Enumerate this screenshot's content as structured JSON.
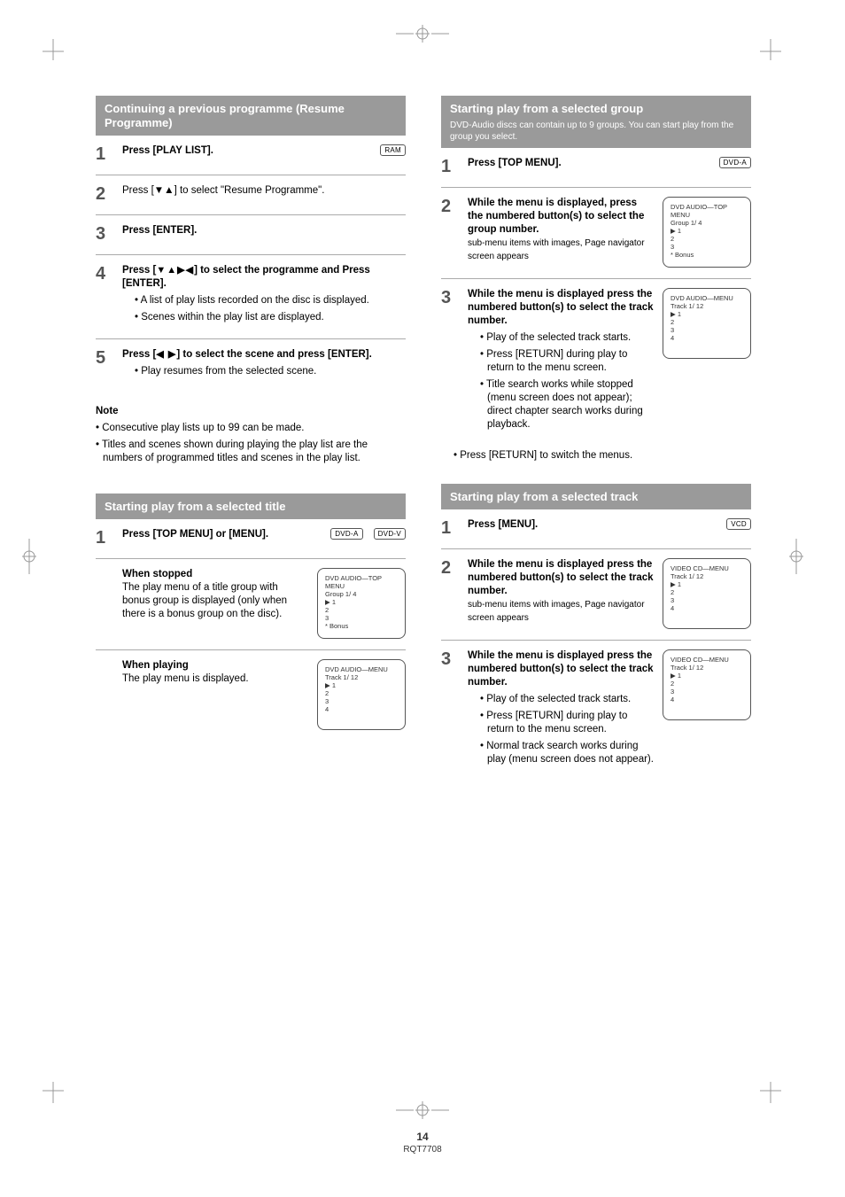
{
  "footer": {
    "page_number": "14",
    "label": "RQT7708"
  },
  "badges": {
    "ram": "RAM",
    "dvd_a": "DVD-A",
    "dvd_v": "DVD-V",
    "vcd": "VCD"
  },
  "left": {
    "section1": {
      "title": "Continuing a previous programme (Resume Programme)",
      "steps": {
        "s1": {
          "text_a": "Press [PLAY LIST].",
          "badge": "RAM"
        },
        "s2": {
          "text": "Press [",
          "mid": "] to select \"Resume Programme\"."
        },
        "s3": {
          "text": "Press [ENTER]."
        },
        "s4": {
          "text_a": "Press [",
          "icons": "▼▲▶◀",
          "text_b": "] to select the programme and Press [ENTER].",
          "bullets": [
            "A list of play lists recorded on the disc is displayed.",
            "Scenes within the play list are displayed."
          ]
        },
        "s5": {
          "text_a": "Press [",
          "icons": "◀ ▶",
          "text_b": "] to select the scene and press [ENTER].",
          "bullet": "Play resumes from the selected scene."
        }
      },
      "notes": {
        "title": "Note",
        "lines": [
          "Consecutive play lists up to 99 can be made.",
          "Titles and scenes shown during playing the play list are the numbers of programmed titles and scenes in the play list."
        ]
      }
    },
    "section2": {
      "title": "Starting play from a selected title",
      "step1": {
        "text": "Press [TOP MENU] or [MENU].",
        "b1": "DVD-A",
        "b2": "DVD-V"
      },
      "when_stopped": {
        "label": "When stopped",
        "text": "The play menu of a title group with bonus group is displayed (only when there is a bonus group on the disc).",
        "display": {
          "l1": "DVD AUDIO—TOP MENU",
          "l2": "Group     1/ 4",
          "l3": "▶                     1",
          "l4": "2",
          "l5": "3",
          "l6": "*  Bonus"
        }
      },
      "when_playing": {
        "label": "When playing",
        "text": "The play menu is displayed.",
        "display": {
          "l1": "DVD AUDIO—MENU",
          "l2": "Track     1/ 12",
          "l3": "▶                     1",
          "l4": "2",
          "l5": "3",
          "l6": "4"
        }
      }
    }
  },
  "right": {
    "section1": {
      "title_l1": "Starting play from a selected group",
      "title_l2": "DVD-Audio discs can contain up to 9 groups. You can start play from the group you select.",
      "step1": {
        "text": "Press [TOP MENU].",
        "badge": "DVD-A"
      },
      "step2": {
        "text": "While the menu is displayed, press the numbered button(s) to select the group number.",
        "sub": "sub-menu items with images, Page navigator screen appears",
        "display": {
          "l1": "DVD AUDIO—TOP MENU",
          "l2": "Group     1/ 4",
          "l3": "▶                     1",
          "l4": "2",
          "l5": "3",
          "l6": "*  Bonus"
        }
      },
      "step3": {
        "text": "While the menu is displayed press the numbered button(s) to select the track number.",
        "bullets": [
          "Play of the selected track starts.",
          "Press [RETURN] during play to return to the menu screen.",
          "Title search works while stopped (menu screen does not appear); direct chapter search works during playback."
        ],
        "display": {
          "l1": "DVD AUDIO—MENU",
          "l2": "Track     1/ 12",
          "l3": "▶                     1",
          "l4": "2",
          "l5": "3",
          "l6": "4"
        }
      },
      "note": "Press [RETURN] to switch the menus."
    },
    "section2": {
      "title": "Starting play from a selected track",
      "step1": {
        "text": "Press [MENU].",
        "badge": "VCD"
      },
      "step2": {
        "text": "While the menu is displayed press the numbered button(s) to select the track number.",
        "sub": "sub-menu items with images, Page navigator screen appears",
        "display": {
          "l1": "VIDEO CD—MENU",
          "l2": "Track     1/ 12",
          "l3": "▶                     1",
          "l4": "2",
          "l5": "3",
          "l6": "4"
        }
      },
      "step3": {
        "text": "While the menu is displayed press the numbered button(s) to select the track number.",
        "bullets": [
          "Play of the selected track starts.",
          "Press [RETURN] during play to return to the menu screen.",
          "Normal track search works during play (menu screen does not appear)."
        ],
        "display": {
          "l1": "VIDEO CD—MENU",
          "l2": "Track     1/ 12",
          "l3": "▶                     1",
          "l4": "2",
          "l5": "3",
          "l6": "4"
        }
      }
    }
  }
}
